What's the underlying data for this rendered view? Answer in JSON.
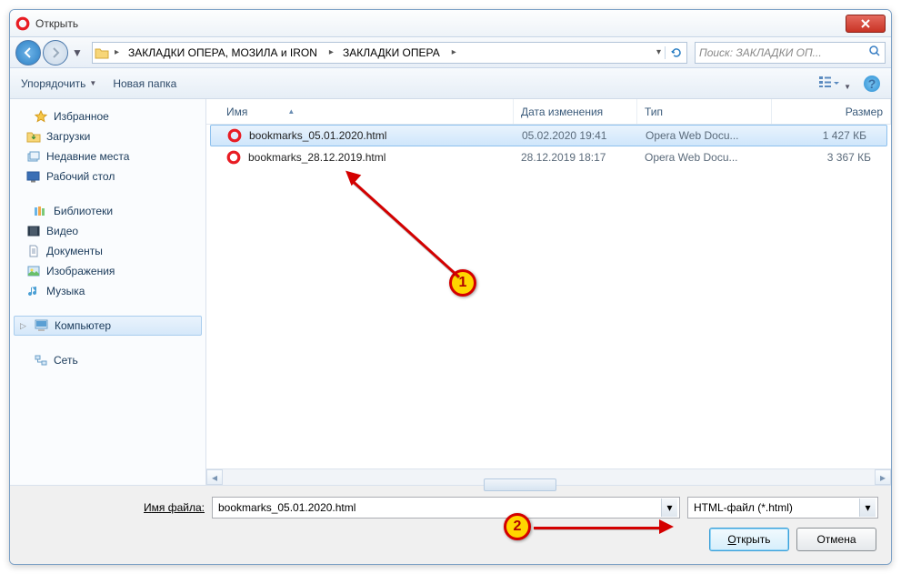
{
  "window": {
    "title": "Открыть"
  },
  "nav": {
    "path_segments": [
      "ЗАКЛАДКИ ОПЕРА,  МОЗИЛА и IRON",
      "ЗАКЛАДКИ ОПЕРА"
    ],
    "search_placeholder": "Поиск: ЗАКЛАДКИ ОП..."
  },
  "toolbar": {
    "organize": "Упорядочить",
    "new_folder": "Новая папка"
  },
  "sidebar": {
    "favorites": {
      "label": "Избранное",
      "items": [
        "Загрузки",
        "Недавние места",
        "Рабочий стол"
      ]
    },
    "libraries": {
      "label": "Библиотеки",
      "items": [
        "Видео",
        "Документы",
        "Изображения",
        "Музыка"
      ]
    },
    "computer": {
      "label": "Компьютер"
    },
    "network": {
      "label": "Сеть"
    }
  },
  "columns": {
    "name": "Имя",
    "date": "Дата изменения",
    "type": "Тип",
    "size": "Размер"
  },
  "files": [
    {
      "name": "bookmarks_05.01.2020.html",
      "date": "05.02.2020 19:41",
      "type": "Opera Web Docu...",
      "size": "1 427 КБ",
      "selected": true
    },
    {
      "name": "bookmarks_28.12.2019.html",
      "date": "28.12.2019 18:17",
      "type": "Opera Web Docu...",
      "size": "3 367 КБ",
      "selected": false
    }
  ],
  "footer": {
    "filename_label": "Имя файла:",
    "filename_value": "bookmarks_05.01.2020.html",
    "filter_value": "HTML-файл (*.html)",
    "open": "Открыть",
    "cancel": "Отмена"
  },
  "annotations": {
    "marker1": "1",
    "marker2": "2"
  }
}
